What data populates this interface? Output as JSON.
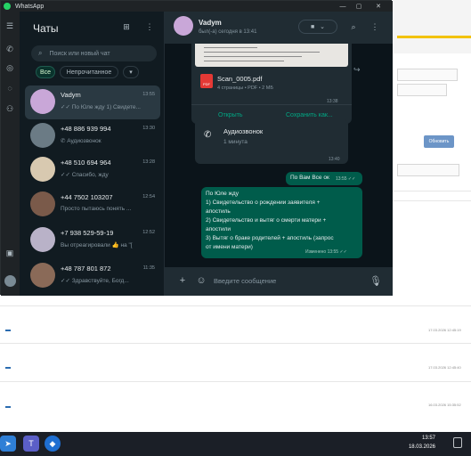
{
  "window": {
    "title": "WhatsApp"
  },
  "window_controls": {
    "minimize": "—",
    "maximize": "▢",
    "close": "✕"
  },
  "rail": {
    "icons": [
      "chats-icon",
      "calls-icon",
      "status-icon",
      "channels-icon",
      "communities-icon",
      "archive-icon",
      "settings-icon"
    ]
  },
  "chatlist": {
    "title": "Чаты",
    "search_placeholder": "Поиск или новый чат",
    "filters": [
      {
        "label": "Все",
        "active": true
      },
      {
        "label": "Непрочитанное",
        "active": false
      },
      {
        "label": "▾",
        "active": false
      }
    ],
    "items": [
      {
        "name": "Vadym",
        "time": "13:55",
        "preview": "✓✓ По Юле жду 1) Свидете...",
        "selected": true,
        "avatar_color": "#c9a7d8"
      },
      {
        "name": "+48 886 939 994",
        "time": "13:30",
        "preview": "✆ Аудиозвонок",
        "selected": false,
        "avatar_color": "#6b7b85"
      },
      {
        "name": "+48 510 694 964",
        "time": "13:28",
        "preview": "✓✓ Спасибо, жду",
        "selected": false,
        "avatar_color": "#d8c9b0"
      },
      {
        "name": "+44 7502 103207",
        "time": "12:54",
        "preview": "Просто пытаюсь понять ...",
        "selected": false,
        "avatar_color": "#7a5a4a"
      },
      {
        "name": "+7 938 529-59-19",
        "time": "12:52",
        "preview": "Вы отреагировали 👍 на \"[",
        "selected": false,
        "avatar_color": "#b9b2c8"
      },
      {
        "name": "+48 787 801 872",
        "time": "11:35",
        "preview": "✓✓ Здравствуйте, Богд...",
        "selected": false,
        "avatar_color": "#8a6a58"
      }
    ]
  },
  "conversation": {
    "contact_name": "Vadym",
    "status": "был(-а) сегодня в 13:41",
    "file": {
      "name": "Scan_0005.pdf",
      "meta": "4 страницы • PDF • 2 МБ",
      "time": "13:38",
      "badge": "PDF"
    },
    "file_actions": {
      "open": "Открыть",
      "save": "Сохранить как..."
    },
    "call": {
      "title": "Аудиозвонок",
      "subtitle": "1 минута",
      "time": "13:40"
    },
    "msg_short": {
      "text": "По Вам Все ок",
      "time": "13:55 ✓✓"
    },
    "msg_long": {
      "lines": [
        "По Юле жду",
        "1) Свидетельство о рождении заявителя +",
        "апостиль",
        "2) Свидетельство и вытяг о смерти матери +",
        "апостили",
        "3) Вытяг о браке родителей + апостиль (запрос",
        "от имени матери)"
      ],
      "time": "Изменено 13:55 ✓✓"
    },
    "composer_placeholder": "Введите сообщение"
  },
  "background": {
    "button": "Обновить",
    "dates": [
      "17.03.2026 12:45:19",
      "17.03.2026 12:45:40",
      "16.03.2026 15:35:52"
    ]
  },
  "taskbar": {
    "time": "13:57",
    "date": "18.03.2026"
  }
}
